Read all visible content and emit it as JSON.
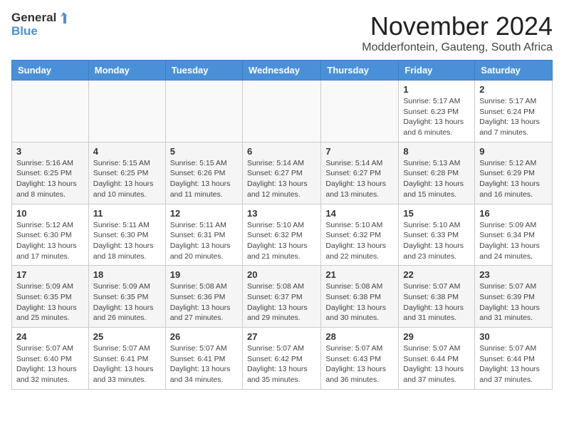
{
  "header": {
    "logo_general": "General",
    "logo_blue": "Blue",
    "month": "November 2024",
    "location": "Modderfontein, Gauteng, South Africa"
  },
  "weekdays": [
    "Sunday",
    "Monday",
    "Tuesday",
    "Wednesday",
    "Thursday",
    "Friday",
    "Saturday"
  ],
  "weeks": [
    [
      {
        "day": "",
        "detail": ""
      },
      {
        "day": "",
        "detail": ""
      },
      {
        "day": "",
        "detail": ""
      },
      {
        "day": "",
        "detail": ""
      },
      {
        "day": "",
        "detail": ""
      },
      {
        "day": "1",
        "detail": "Sunrise: 5:17 AM\nSunset: 6:23 PM\nDaylight: 13 hours and 6 minutes."
      },
      {
        "day": "2",
        "detail": "Sunrise: 5:17 AM\nSunset: 6:24 PM\nDaylight: 13 hours and 7 minutes."
      }
    ],
    [
      {
        "day": "3",
        "detail": "Sunrise: 5:16 AM\nSunset: 6:25 PM\nDaylight: 13 hours and 8 minutes."
      },
      {
        "day": "4",
        "detail": "Sunrise: 5:15 AM\nSunset: 6:25 PM\nDaylight: 13 hours and 10 minutes."
      },
      {
        "day": "5",
        "detail": "Sunrise: 5:15 AM\nSunset: 6:26 PM\nDaylight: 13 hours and 11 minutes."
      },
      {
        "day": "6",
        "detail": "Sunrise: 5:14 AM\nSunset: 6:27 PM\nDaylight: 13 hours and 12 minutes."
      },
      {
        "day": "7",
        "detail": "Sunrise: 5:14 AM\nSunset: 6:27 PM\nDaylight: 13 hours and 13 minutes."
      },
      {
        "day": "8",
        "detail": "Sunrise: 5:13 AM\nSunset: 6:28 PM\nDaylight: 13 hours and 15 minutes."
      },
      {
        "day": "9",
        "detail": "Sunrise: 5:12 AM\nSunset: 6:29 PM\nDaylight: 13 hours and 16 minutes."
      }
    ],
    [
      {
        "day": "10",
        "detail": "Sunrise: 5:12 AM\nSunset: 6:30 PM\nDaylight: 13 hours and 17 minutes."
      },
      {
        "day": "11",
        "detail": "Sunrise: 5:11 AM\nSunset: 6:30 PM\nDaylight: 13 hours and 18 minutes."
      },
      {
        "day": "12",
        "detail": "Sunrise: 5:11 AM\nSunset: 6:31 PM\nDaylight: 13 hours and 20 minutes."
      },
      {
        "day": "13",
        "detail": "Sunrise: 5:10 AM\nSunset: 6:32 PM\nDaylight: 13 hours and 21 minutes."
      },
      {
        "day": "14",
        "detail": "Sunrise: 5:10 AM\nSunset: 6:32 PM\nDaylight: 13 hours and 22 minutes."
      },
      {
        "day": "15",
        "detail": "Sunrise: 5:10 AM\nSunset: 6:33 PM\nDaylight: 13 hours and 23 minutes."
      },
      {
        "day": "16",
        "detail": "Sunrise: 5:09 AM\nSunset: 6:34 PM\nDaylight: 13 hours and 24 minutes."
      }
    ],
    [
      {
        "day": "17",
        "detail": "Sunrise: 5:09 AM\nSunset: 6:35 PM\nDaylight: 13 hours and 25 minutes."
      },
      {
        "day": "18",
        "detail": "Sunrise: 5:09 AM\nSunset: 6:35 PM\nDaylight: 13 hours and 26 minutes."
      },
      {
        "day": "19",
        "detail": "Sunrise: 5:08 AM\nSunset: 6:36 PM\nDaylight: 13 hours and 27 minutes."
      },
      {
        "day": "20",
        "detail": "Sunrise: 5:08 AM\nSunset: 6:37 PM\nDaylight: 13 hours and 29 minutes."
      },
      {
        "day": "21",
        "detail": "Sunrise: 5:08 AM\nSunset: 6:38 PM\nDaylight: 13 hours and 30 minutes."
      },
      {
        "day": "22",
        "detail": "Sunrise: 5:07 AM\nSunset: 6:38 PM\nDaylight: 13 hours and 31 minutes."
      },
      {
        "day": "23",
        "detail": "Sunrise: 5:07 AM\nSunset: 6:39 PM\nDaylight: 13 hours and 31 minutes."
      }
    ],
    [
      {
        "day": "24",
        "detail": "Sunrise: 5:07 AM\nSunset: 6:40 PM\nDaylight: 13 hours and 32 minutes."
      },
      {
        "day": "25",
        "detail": "Sunrise: 5:07 AM\nSunset: 6:41 PM\nDaylight: 13 hours and 33 minutes."
      },
      {
        "day": "26",
        "detail": "Sunrise: 5:07 AM\nSunset: 6:41 PM\nDaylight: 13 hours and 34 minutes."
      },
      {
        "day": "27",
        "detail": "Sunrise: 5:07 AM\nSunset: 6:42 PM\nDaylight: 13 hours and 35 minutes."
      },
      {
        "day": "28",
        "detail": "Sunrise: 5:07 AM\nSunset: 6:43 PM\nDaylight: 13 hours and 36 minutes."
      },
      {
        "day": "29",
        "detail": "Sunrise: 5:07 AM\nSunset: 6:44 PM\nDaylight: 13 hours and 37 minutes."
      },
      {
        "day": "30",
        "detail": "Sunrise: 5:07 AM\nSunset: 6:44 PM\nDaylight: 13 hours and 37 minutes."
      }
    ]
  ]
}
